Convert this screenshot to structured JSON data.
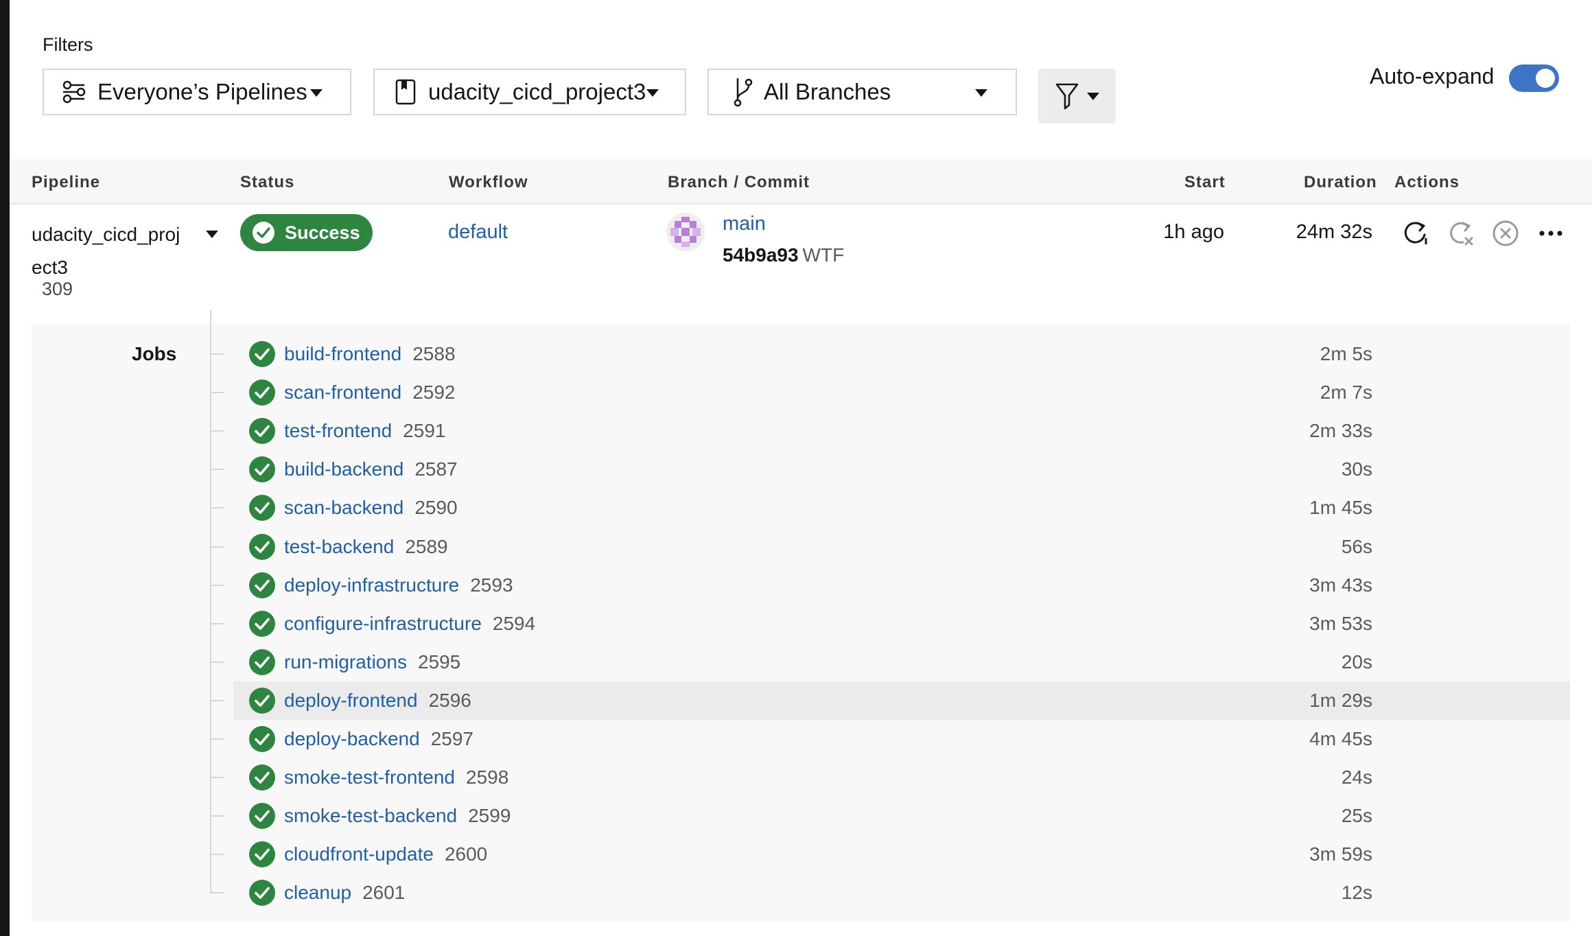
{
  "filters": {
    "label": "Filters",
    "pipelines": "Everyone’s Pipelines",
    "project": "udacity_cicd_project3",
    "branches": "All Branches",
    "auto_expand_label": "Auto-expand",
    "auto_expand_on": true
  },
  "table": {
    "headers": {
      "pipeline": "Pipeline",
      "status": "Status",
      "workflow": "Workflow",
      "branch_commit": "Branch / Commit",
      "start": "Start",
      "duration": "Duration",
      "actions": "Actions"
    }
  },
  "pipeline": {
    "name": "udacity_cicd_project3",
    "number": "309",
    "status": "Success",
    "workflow": "default",
    "branch": "main",
    "commit_hash": "54b9a93",
    "commit_message": "WTF",
    "start": "1h ago",
    "duration": "24m 32s",
    "actions": [
      "rerun-icon",
      "rerun-failed-icon",
      "cancel-icon",
      "more-icon"
    ]
  },
  "jobs": {
    "label": "Jobs",
    "items": [
      {
        "name": "build-frontend",
        "number": "2588",
        "duration": "2m 5s"
      },
      {
        "name": "scan-frontend",
        "number": "2592",
        "duration": "2m 7s"
      },
      {
        "name": "test-frontend",
        "number": "2591",
        "duration": "2m 33s"
      },
      {
        "name": "build-backend",
        "number": "2587",
        "duration": "30s"
      },
      {
        "name": "scan-backend",
        "number": "2590",
        "duration": "1m 45s"
      },
      {
        "name": "test-backend",
        "number": "2589",
        "duration": "56s"
      },
      {
        "name": "deploy-infrastructure",
        "number": "2593",
        "duration": "3m 43s"
      },
      {
        "name": "configure-infrastructure",
        "number": "2594",
        "duration": "3m 53s"
      },
      {
        "name": "run-migrations",
        "number": "2595",
        "duration": "20s"
      },
      {
        "name": "deploy-frontend",
        "number": "2596",
        "duration": "1m 29s",
        "highlighted": true
      },
      {
        "name": "deploy-backend",
        "number": "2597",
        "duration": "4m 45s"
      },
      {
        "name": "smoke-test-frontend",
        "number": "2598",
        "duration": "24s"
      },
      {
        "name": "smoke-test-backend",
        "number": "2599",
        "duration": "25s"
      },
      {
        "name": "cloudfront-update",
        "number": "2600",
        "duration": "3m 59s"
      },
      {
        "name": "cleanup",
        "number": "2601",
        "duration": "12s"
      }
    ]
  },
  "colors": {
    "success": "#2e8540",
    "link": "#1f5fa8",
    "toggle": "#3d74c4"
  }
}
